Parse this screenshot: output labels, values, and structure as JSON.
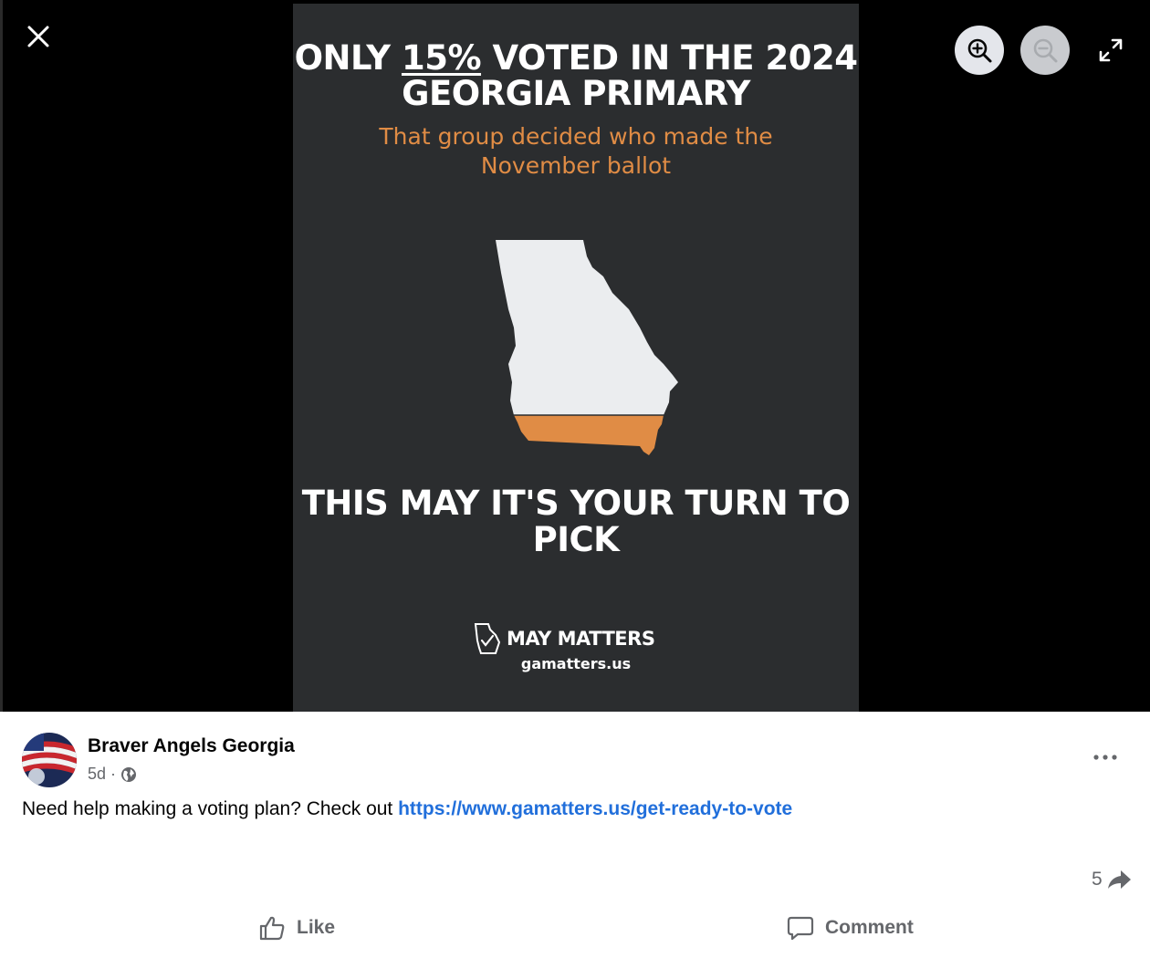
{
  "viewer": {
    "controls": {
      "close_icon": "close-icon",
      "zoom_in_icon": "zoom-in-icon",
      "zoom_out_icon": "zoom-out-icon",
      "fullscreen_icon": "expand-icon"
    },
    "poster": {
      "headline_prefix": "ONLY",
      "headline_pct": "15%",
      "headline_rest": "VOTED IN THE 2024 GEORGIA PRIMARY",
      "subhead": "That group decided who made the November ballot",
      "cta": "THIS MAY IT'S YOUR TURN TO PICK",
      "brand": "MAY MATTERS",
      "url": "gamatters.us",
      "colors": {
        "background": "#2b2d2f",
        "accent": "#e08c45",
        "map": "#ebedef"
      }
    }
  },
  "post": {
    "author": "Braver Angels Georgia",
    "time": "5d",
    "separator": "·",
    "audience_icon": "globe-icon",
    "text": "Need help making a voting plan? Check out ",
    "link": "https://www.gamatters.us/get-ready-to-vote",
    "share_count": "5",
    "actions": {
      "like": "Like",
      "comment": "Comment"
    },
    "colors": {
      "link": "#216fdb",
      "secondary_text": "#65676b"
    }
  }
}
